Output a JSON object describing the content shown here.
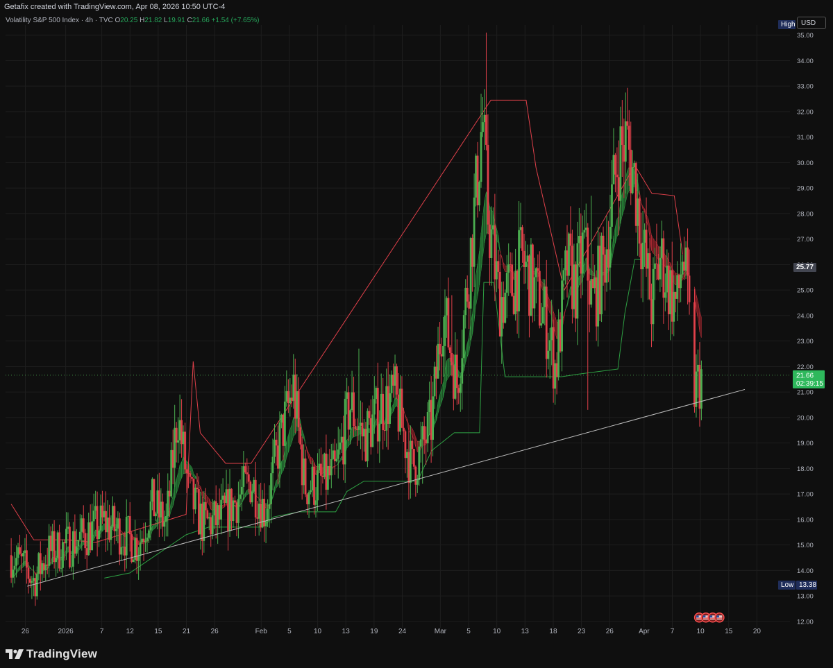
{
  "header": {
    "attribution": "Getafix created with TradingView.com, Apr 08, 2026 10:50 UTC-4"
  },
  "legend": {
    "symbol": "Volatility S&P 500 Index · 4h · TVC",
    "open_label": "O",
    "open": "20.25",
    "high_label": "H",
    "high": "21.82",
    "low_label": "L",
    "low": "19.91",
    "close_label": "C",
    "close": "21.66",
    "change": "+1.54 (+7.65%)"
  },
  "price_scale": {
    "currency": "USD",
    "high_badge": "High",
    "low_badge": "Low",
    "low_value": "13.38",
    "last_price": "21.66",
    "countdown": "02:39:15",
    "band_value": "25.77"
  },
  "branding": {
    "logo_text": "TradingView"
  },
  "colors": {
    "background": "#0f0f0f",
    "up": "#4caf50",
    "down": "#e0404a",
    "grid": "#1e1e1e",
    "trendline": "#bdbdbd",
    "stop_up": "#2ea043",
    "stop_down": "#e0404a",
    "label_green": "#2eb85c",
    "label_gray": "#434651",
    "label_navy": "#1f2d5a"
  },
  "icons": [
    "us-flag-icon",
    "us-flag-icon",
    "us-flag-icon",
    "us-flag-icon"
  ],
  "chart_data": {
    "type": "candlestick",
    "yticks": [
      12,
      13,
      14,
      15,
      16,
      17,
      18,
      19,
      20,
      21,
      22,
      23,
      24,
      25,
      26,
      27,
      28,
      29,
      30,
      31,
      32,
      33,
      34,
      35
    ],
    "ylim": [
      11.75,
      35.4
    ],
    "grid": true,
    "xticks": [
      {
        "label": "26",
        "t": 0.5
      },
      {
        "label": "2026",
        "t": 1.93
      },
      {
        "label": "7",
        "t": 3.21
      },
      {
        "label": "12",
        "t": 4.21
      },
      {
        "label": "15",
        "t": 5.21
      },
      {
        "label": "21",
        "t": 6.21
      },
      {
        "label": "26",
        "t": 7.21
      },
      {
        "label": "Feb",
        "t": 8.86
      },
      {
        "label": "5",
        "t": 9.86
      },
      {
        "label": "10",
        "t": 10.86
      },
      {
        "label": "13",
        "t": 11.86
      },
      {
        "label": "19",
        "t": 12.86
      },
      {
        "label": "24",
        "t": 13.86
      },
      {
        "label": "Mar",
        "t": 15.21
      },
      {
        "label": "5",
        "t": 16.21
      },
      {
        "label": "10",
        "t": 17.21
      },
      {
        "label": "13",
        "t": 18.21
      },
      {
        "label": "18",
        "t": 19.21
      },
      {
        "label": "23",
        "t": 20.21
      },
      {
        "label": "26",
        "t": 21.21
      },
      {
        "label": "Apr",
        "t": 22.43
      },
      {
        "label": "7",
        "t": 23.43
      },
      {
        "label": "10",
        "t": 24.43
      },
      {
        "label": "15",
        "t": 25.43
      },
      {
        "label": "20",
        "t": 26.43
      }
    ],
    "trendline": [
      [
        0.57,
        13.38
      ],
      [
        26.0,
        21.1
      ]
    ],
    "guide_price": 21.66,
    "anchors": [
      [
        0,
        14.6
      ],
      [
        0.4,
        14.2
      ],
      [
        0.8,
        13.6
      ],
      [
        1.3,
        14.7
      ],
      [
        1.9,
        14.9
      ],
      [
        2.5,
        15.3
      ],
      [
        3.3,
        15.9
      ],
      [
        4.0,
        15.4
      ],
      [
        4.5,
        15.0
      ],
      [
        5.0,
        16.6
      ],
      [
        5.5,
        15.8
      ],
      [
        5.9,
        20.2
      ],
      [
        6.3,
        17.0
      ],
      [
        6.8,
        15.8
      ],
      [
        7.4,
        16.0
      ],
      [
        8.0,
        16.8
      ],
      [
        8.5,
        17.5
      ],
      [
        9.0,
        16.3
      ],
      [
        9.5,
        19.0
      ],
      [
        10.0,
        21.2
      ],
      [
        10.4,
        17.3
      ],
      [
        10.9,
        17.4
      ],
      [
        11.5,
        17.8
      ],
      [
        12.0,
        20.5
      ],
      [
        12.5,
        19.2
      ],
      [
        13.1,
        20.4
      ],
      [
        13.6,
        20.8
      ],
      [
        14.2,
        18.0
      ],
      [
        14.5,
        18.6
      ],
      [
        14.9,
        19.8
      ],
      [
        15.3,
        24.3
      ],
      [
        15.8,
        21.3
      ],
      [
        16.2,
        25.5
      ],
      [
        16.5,
        29.1
      ],
      [
        16.7,
        31.8
      ],
      [
        16.9,
        27.9
      ],
      [
        17.3,
        24.6
      ],
      [
        17.7,
        25.0
      ],
      [
        18.1,
        26.2
      ],
      [
        18.5,
        25.1
      ],
      [
        18.9,
        24.0
      ],
      [
        19.3,
        21.9
      ],
      [
        19.7,
        26.0
      ],
      [
        20.0,
        25.1
      ],
      [
        20.3,
        26.8
      ],
      [
        20.6,
        24.5
      ],
      [
        21.0,
        26.0
      ],
      [
        21.5,
        30.2
      ],
      [
        21.8,
        30.9
      ],
      [
        22.1,
        29.3
      ],
      [
        22.4,
        26.6
      ],
      [
        22.7,
        24.4
      ],
      [
        23.0,
        26.3
      ],
      [
        23.3,
        25.2
      ],
      [
        23.6,
        24.3
      ],
      [
        23.8,
        26.6
      ],
      [
        24.0,
        24.1
      ],
      [
        24.2,
        21.0
      ],
      [
        24.5,
        21.7
      ]
    ],
    "spikes": [
      [
        16.85,
        35.1
      ],
      [
        16.9,
        31.9
      ],
      [
        17.12,
        27.2
      ],
      [
        5.98,
        20.9
      ],
      [
        10.1,
        21.7
      ],
      [
        12.35,
        22.7
      ],
      [
        15.6,
        24.8
      ],
      [
        16.45,
        29.3
      ],
      [
        20.55,
        28.7
      ],
      [
        20.45,
        20.3
      ],
      [
        21.92,
        31.6
      ],
      [
        22.9,
        27.6
      ],
      [
        17.4,
        22.1
      ],
      [
        19.25,
        21.4
      ],
      [
        24.25,
        20.0
      ],
      [
        14.55,
        17.4
      ]
    ],
    "gaps": [
      [
        24.05,
        24.2
      ]
    ],
    "stop_up": [
      [
        3.3,
        13.7
      ],
      [
        4.2,
        13.9
      ],
      [
        5.0,
        14.5
      ],
      [
        6.2,
        15.4
      ],
      [
        7.0,
        15.7
      ],
      [
        8.9,
        15.7
      ],
      [
        9.3,
        16.1
      ],
      [
        10.2,
        16.3
      ],
      [
        11.5,
        16.3
      ],
      [
        11.9,
        17.1
      ],
      [
        12.5,
        17.5
      ],
      [
        14.4,
        17.5
      ],
      [
        14.9,
        18.7
      ],
      [
        15.7,
        19.4
      ],
      [
        16.6,
        19.4
      ],
      [
        16.75,
        25.3
      ],
      [
        17.1,
        25.3
      ],
      [
        17.5,
        21.6
      ],
      [
        19.5,
        21.6
      ],
      [
        20.1,
        21.7
      ],
      [
        21.5,
        21.9
      ],
      [
        21.75,
        24.1
      ],
      [
        22.1,
        26.2
      ],
      [
        22.3,
        26.2
      ]
    ],
    "stop_down": [
      [
        0,
        16.6
      ],
      [
        0.8,
        15.2
      ],
      [
        2.0,
        15.2
      ],
      [
        3.0,
        15.1
      ],
      [
        6.2,
        16.2
      ],
      [
        6.45,
        22.2
      ],
      [
        6.7,
        19.4
      ],
      [
        7.6,
        18.2
      ],
      [
        8.2,
        18.2
      ],
      [
        8.5,
        18.2
      ],
      [
        17.0,
        32.45
      ],
      [
        18.25,
        32.45
      ],
      [
        18.6,
        29.8
      ],
      [
        19.6,
        25.0
      ],
      [
        22.1,
        29.9
      ],
      [
        22.7,
        28.8
      ],
      [
        23.5,
        28.7
      ],
      [
        23.8,
        26.4
      ]
    ],
    "signals": [
      [
        24.38,
        12.15
      ],
      [
        24.62,
        12.15
      ],
      [
        24.86,
        12.15
      ],
      [
        25.1,
        12.15
      ]
    ]
  }
}
